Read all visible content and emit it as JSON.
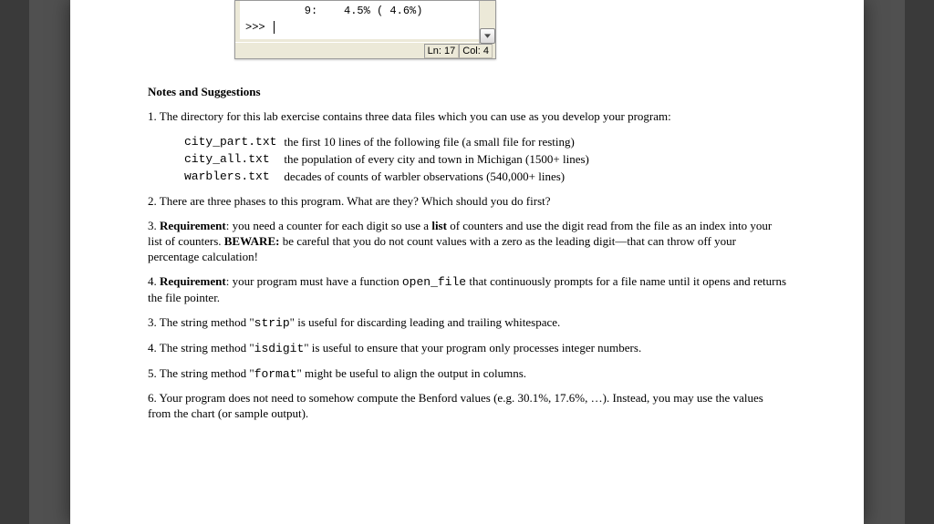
{
  "code_window": {
    "line1": "         9:    4.5% ( 4.6%)",
    "prompt": ">>> ",
    "status_ln": "Ln: 17",
    "status_col": "Col: 4"
  },
  "heading": "Notes and Suggestions",
  "p1_a": "1.  The directory for this lab exercise contains three data files which you can use as you develop your program:",
  "files": [
    {
      "name": "city_part.txt",
      "desc": "the first 10 lines of the following file (a small file for resting)"
    },
    {
      "name": "city_all.txt",
      "desc": "the population of every city and town in Michigan (1500+ lines)"
    },
    {
      "name": "warblers.txt",
      "desc": "decades of counts of warbler observations (540,000+ lines)"
    }
  ],
  "p2": "2.  There are three phases to this program.  What are they?  Which should you do first?",
  "p3a": "3.  ",
  "p3b": "Requirement",
  "p3c": ": you need a counter for each digit so use a ",
  "p3d": "list",
  "p3e": " of counters and use the digit read from the file as an index into your list of counters. ",
  "p3f": "BEWARE:",
  "p3g": " be careful that you do not count values with a zero as the leading digit—that can throw off your percentage calculation!",
  "p4a": "4. ",
  "p4b": "Requirement",
  "p4c": ": your program must have a function ",
  "p4d": "open_file",
  "p4e": " that continuously prompts for a file name until it opens and returns the file pointer.",
  "p5a": "3.  The string method \"",
  "p5b": "strip",
  "p5c": "\" is useful for discarding leading and trailing whitespace.",
  "p6a": "4.  The string method \"",
  "p6b": "isdigit",
  "p6c": "\" is useful to ensure that your program only processes integer numbers.",
  "p7a": "5.  The string method \"",
  "p7b": "format",
  "p7c": "\" might be useful to align the output in columns.",
  "p8": "6.  Your program does not need to somehow compute the Benford values (e.g. 30.1%, 17.6%, …). Instead, you may use the values from the chart (or sample output)."
}
